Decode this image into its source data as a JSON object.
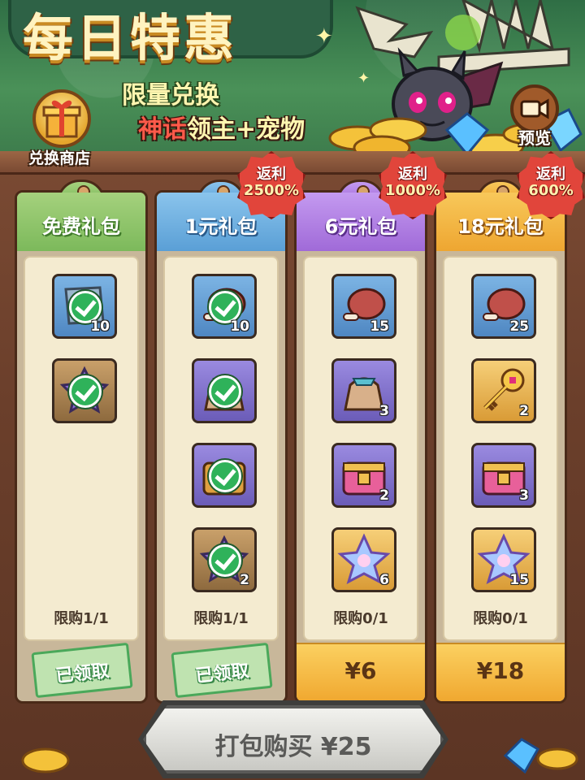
{
  "banner": {
    "title": "每日特惠",
    "subtitle_line1": "限量兑换",
    "subtitle_myth": "神话",
    "subtitle_rest": "领主+宠物"
  },
  "shop_button": {
    "label": "兑换商店",
    "icon": "gift-icon"
  },
  "preview_button": {
    "label": "预览",
    "icon": "video-camera-icon"
  },
  "columns": [
    {
      "title": "免费礼包",
      "color": "#7cb95b",
      "limit": "限购1/1",
      "claimed_label": "已领取",
      "items": [
        {
          "icon": "scroll-icon",
          "qty": "10",
          "claimed": true
        },
        {
          "icon": "purple-star-shard-icon",
          "qty": "",
          "claimed": true
        }
      ]
    },
    {
      "title": "1元礼包",
      "color": "#5a9fd6",
      "limit": "限购1/1",
      "claimed_label": "已领取",
      "rebate": {
        "label": "返利",
        "value": "2500%"
      },
      "items": [
        {
          "icon": "meat-icon",
          "qty": "10",
          "claimed": true
        },
        {
          "icon": "treasure-sack-icon",
          "qty": "",
          "claimed": true
        },
        {
          "icon": "gold-chest-icon",
          "qty": "",
          "claimed": true
        },
        {
          "icon": "purple-star-shard-icon",
          "qty": "2",
          "claimed": true
        }
      ]
    },
    {
      "title": "6元礼包",
      "color": "#a06ad8",
      "limit": "限购0/1",
      "price": "¥6",
      "rebate": {
        "label": "返利",
        "value": "1000%"
      },
      "items": [
        {
          "icon": "meat-icon",
          "qty": "15"
        },
        {
          "icon": "treasure-sack-icon",
          "qty": "3"
        },
        {
          "icon": "pink-chest-icon",
          "qty": "2"
        },
        {
          "icon": "rainbow-star-icon",
          "qty": "6"
        }
      ]
    },
    {
      "title": "18元礼包",
      "color": "#eea631",
      "limit": "限购0/1",
      "price": "¥18",
      "rebate": {
        "label": "返利",
        "value": "600%"
      },
      "items": [
        {
          "icon": "meat-icon",
          "qty": "25"
        },
        {
          "icon": "golden-key-icon",
          "qty": "2"
        },
        {
          "icon": "pink-chest-icon",
          "qty": "3"
        },
        {
          "icon": "rainbow-star-icon",
          "qty": "15"
        }
      ]
    }
  ],
  "bundle_button": {
    "label": "打包购买 ¥25"
  }
}
